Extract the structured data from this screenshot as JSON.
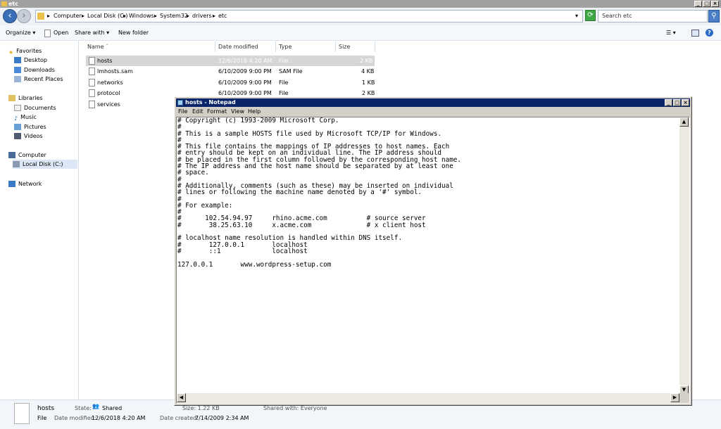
{
  "explorer": {
    "title": "etc",
    "breadcrumb": [
      "Computer",
      "Local Disk (C:)",
      "Windows",
      "System32",
      "drivers",
      "etc"
    ],
    "search_placeholder": "Search etc",
    "toolbar": {
      "organize": "Organize",
      "open": "Open",
      "share_with": "Share with",
      "new_folder": "New folder"
    }
  },
  "navpane": {
    "favorites": "Favorites",
    "desktop": "Desktop",
    "downloads": "Downloads",
    "recent_places": "Recent Places",
    "libraries": "Libraries",
    "documents": "Documents",
    "music": "Music",
    "pictures": "Pictures",
    "videos": "Videos",
    "computer": "Computer",
    "local_disk": "Local Disk (C:)",
    "network": "Network"
  },
  "filelist": {
    "columns": {
      "name": "Name",
      "date": "Date modified",
      "type": "Type",
      "size": "Size"
    },
    "rows": [
      {
        "name": "hosts",
        "date": "12/6/2018 4:20 AM",
        "type": "File",
        "size": "2 KB"
      },
      {
        "name": "lmhosts.sam",
        "date": "6/10/2009 9:00 PM",
        "type": "SAM File",
        "size": "4 KB"
      },
      {
        "name": "networks",
        "date": "6/10/2009 9:00 PM",
        "type": "File",
        "size": "1 KB"
      },
      {
        "name": "protocol",
        "date": "6/10/2009 9:00 PM",
        "type": "File",
        "size": "2 KB"
      },
      {
        "name": "services",
        "date": "",
        "type": "",
        "size": ""
      }
    ]
  },
  "details": {
    "name": "hosts",
    "kind": "File",
    "state_label": "State:",
    "state_value": "Shared",
    "modified_label": "Date modified:",
    "modified_value": "12/6/2018 4:20 AM",
    "size": "Size: 1.22 KB",
    "shared_with": "Shared with: Everyone",
    "created_label": "Date created:",
    "created_value": "7/14/2009 2:34 AM"
  },
  "notepad": {
    "title": "hosts - Notepad",
    "menu": {
      "file": "File",
      "edit": "Edit",
      "format": "Format",
      "view": "View",
      "help": "Help"
    },
    "content": "# Copyright (c) 1993-2009 Microsoft Corp.\n#\n# This is a sample HOSTS file used by Microsoft TCP/IP for Windows.\n#\n# This file contains the mappings of IP addresses to host names. Each\n# entry should be kept on an individual line. The IP address should\n# be placed in the first column followed by the corresponding host name.\n# The IP address and the host name should be separated by at least one\n# space.\n#\n# Additionally, comments (such as these) may be inserted on individual\n# lines or following the machine name denoted by a '#' symbol.\n#\n# For example:\n#\n#      102.54.94.97     rhino.acme.com          # source server\n#       38.25.63.10     x.acme.com              # x client host\n\n# localhost name resolution is handled within DNS itself.\n#\t127.0.0.1       localhost\n#\t::1             localhost\n\n127.0.0.1       www.wordpress-setup.com"
  }
}
